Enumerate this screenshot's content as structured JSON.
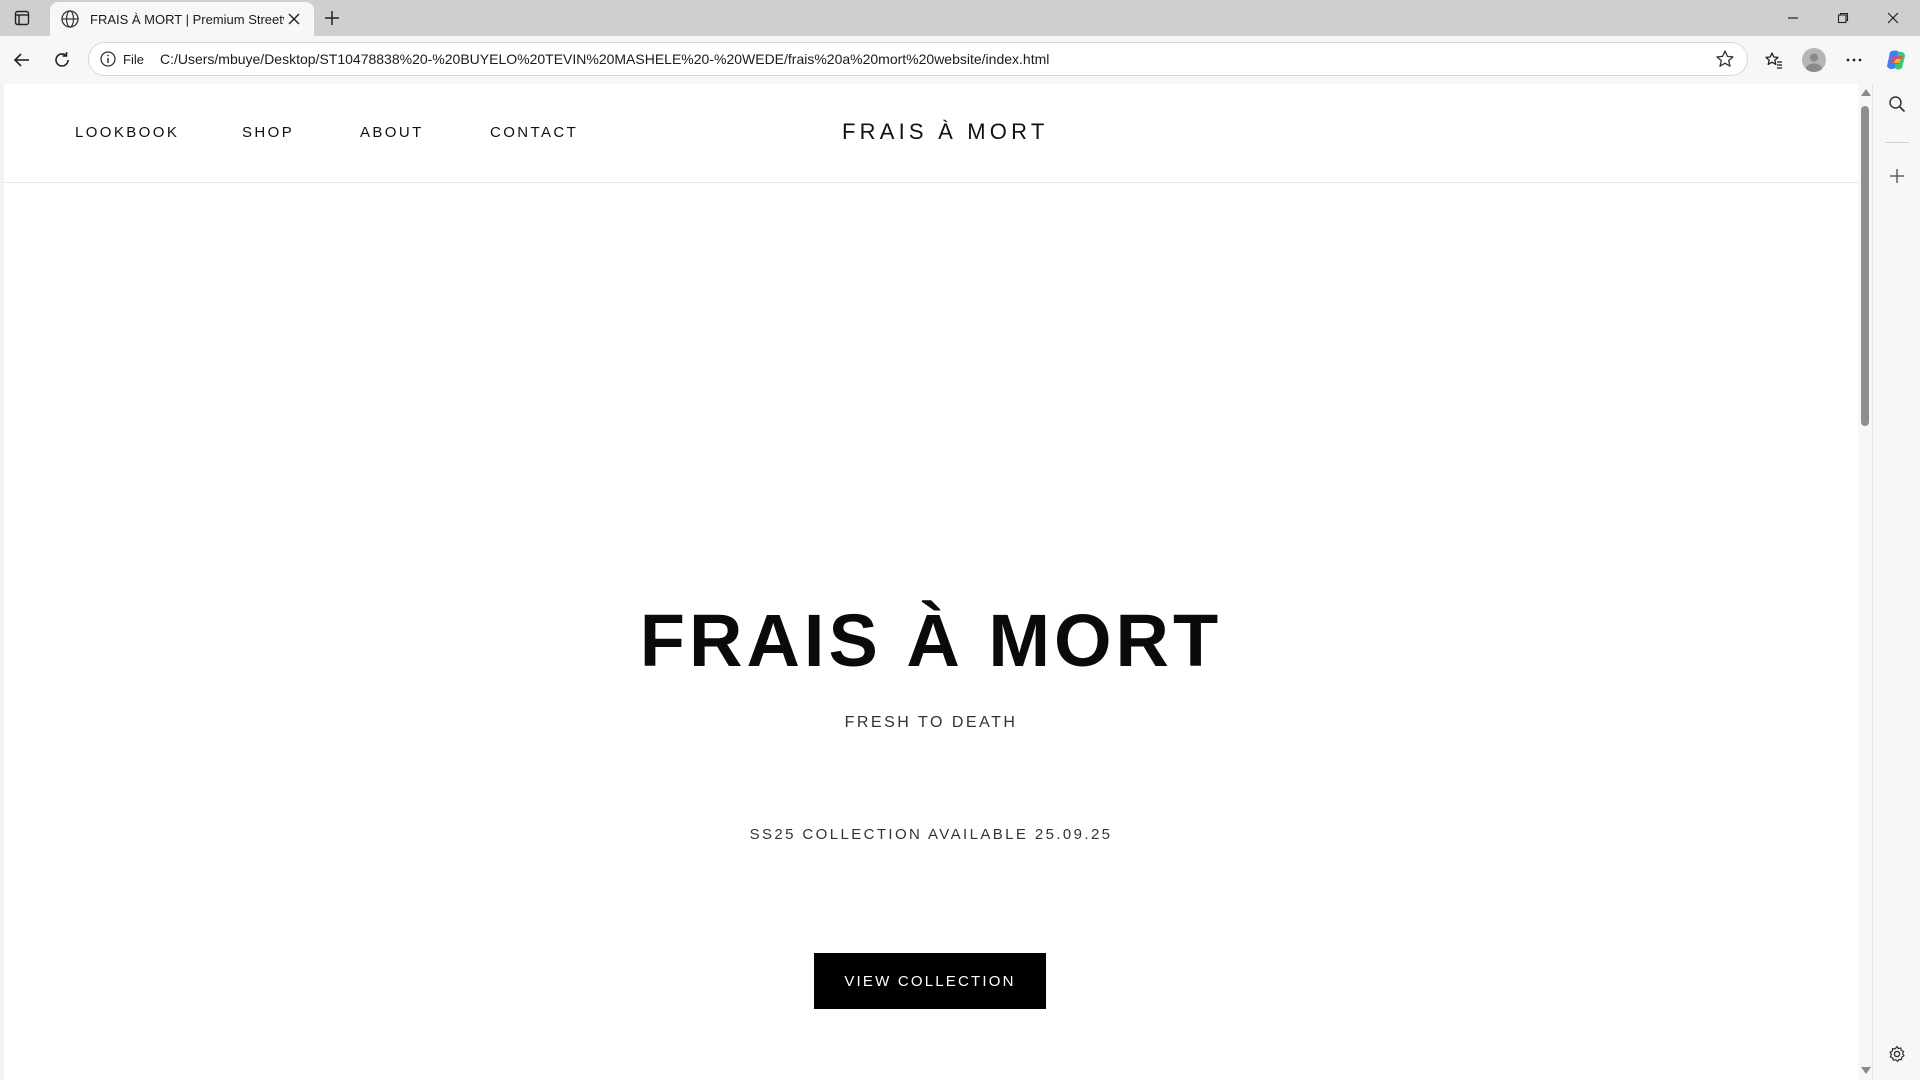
{
  "browser": {
    "tab_title": "FRAIS À MORT | Premium Streetw",
    "address_scheme_label": "File",
    "address_url": "C:/Users/mbuye/Desktop/ST10478838%20-%20BUYELO%20TEVIN%20MASHELE%20-%20WEDE/frais%20a%20mort%20website/index.html"
  },
  "site": {
    "nav_links": [
      "LOOKBOOK",
      "SHOP",
      "ABOUT",
      "CONTACT"
    ],
    "brand": "FRAIS À MORT"
  },
  "hero": {
    "title": "FRAIS À MORT",
    "subtitle": "FRESH TO DEATH",
    "availability": "SS25 COLLECTION AVAILABLE 25.09.25",
    "cta_label": "VIEW COLLECTION"
  },
  "colors": {
    "accent": "#000000",
    "background": "#ffffff",
    "chrome": "#f7f7f7"
  }
}
